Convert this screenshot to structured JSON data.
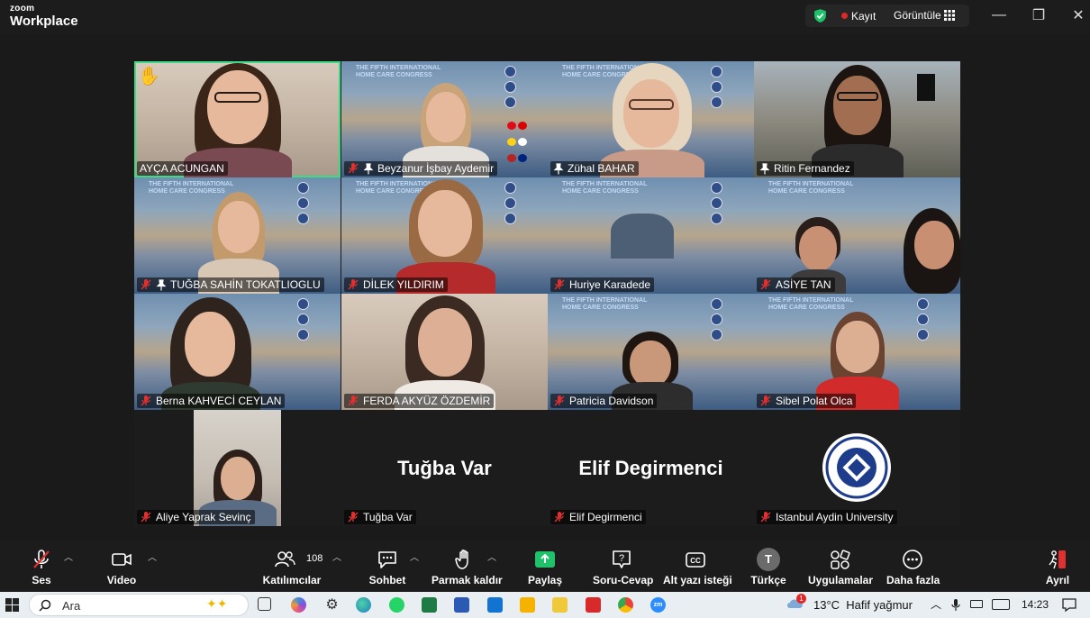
{
  "window": {
    "logo_line1": "zoom",
    "logo_line2": "Workplace",
    "recording_label": "Kayıt",
    "view_label": "Görüntüle",
    "controls": {
      "minimize": "—",
      "restore": "❐",
      "close": "✕"
    }
  },
  "participants": [
    {
      "name": "AYÇA ACUNGAN",
      "muted": false,
      "pinned": false,
      "hand_raised": true,
      "bg": "home",
      "active_speaker": true
    },
    {
      "name": "Beyzanur İşbay Aydemir",
      "muted": true,
      "pinned": true,
      "bg": "poster"
    },
    {
      "name": "Zühal BAHAR",
      "muted": false,
      "pinned": true,
      "bg": "poster"
    },
    {
      "name": "Ritin Fernandez",
      "muted": false,
      "pinned": true,
      "bg": "campus"
    },
    {
      "name": "TUĞBA SAHİN TOKATLIOGLU",
      "muted": true,
      "pinned": true,
      "bg": "poster"
    },
    {
      "name": "DİLEK YILDIRIM",
      "muted": true,
      "pinned": false,
      "bg": "poster"
    },
    {
      "name": "Huriye Karadede",
      "muted": true,
      "pinned": false,
      "bg": "poster"
    },
    {
      "name": "ASİYE TAN",
      "muted": true,
      "pinned": false,
      "bg": "poster"
    },
    {
      "name": "Berna KAHVECİ CEYLAN",
      "muted": true,
      "pinned": false,
      "bg": "poster"
    },
    {
      "name": "FERDA AKYÜZ ÖZDEMİR",
      "muted": true,
      "pinned": false,
      "bg": "home"
    },
    {
      "name": "Patricia Davidson",
      "muted": true,
      "pinned": false,
      "bg": "poster"
    },
    {
      "name": "Sibel Polat Olca",
      "muted": true,
      "pinned": false,
      "bg": "poster"
    },
    {
      "name": "Aliye Yaprak Sevinç",
      "muted": true,
      "pinned": false,
      "bg": "inset"
    },
    {
      "name": "Tuğba Var",
      "muted": true,
      "pinned": false,
      "bg": "blank",
      "display_name": "Tuğba Var"
    },
    {
      "name": "Elif Degirmenci",
      "muted": true,
      "pinned": false,
      "bg": "blank",
      "display_name": "Elif Degirmenci"
    },
    {
      "name": "Istanbul Aydin University",
      "muted": true,
      "pinned": false,
      "bg": "logo"
    }
  ],
  "poster": {
    "line1": "THE FIFTH INTERNATIONAL",
    "line2": "HOME CARE CONGRESS"
  },
  "toolbar": {
    "audio": "Ses",
    "video": "Video",
    "participants_count": "108",
    "participants": "Katılımcılar",
    "chat": "Sohbet",
    "raise_hand": "Parmak kaldır",
    "share": "Paylaş",
    "qa": "Soru-Cevap",
    "captions": "Alt yazı isteği",
    "language": "Türkçe",
    "language_badge": "T",
    "apps": "Uygulamalar",
    "more": "Daha fazla",
    "leave": "Ayrıl"
  },
  "taskbar": {
    "search_placeholder": "Ara",
    "weather": "13°C  Hafif yağmur",
    "weather_badge": "1",
    "time": "14:23"
  },
  "colors": {
    "active_speaker_border": "#3ddc84",
    "muted_red": "#e0302f",
    "share_green": "#1fc26b",
    "leave_red": "#e0302f"
  }
}
